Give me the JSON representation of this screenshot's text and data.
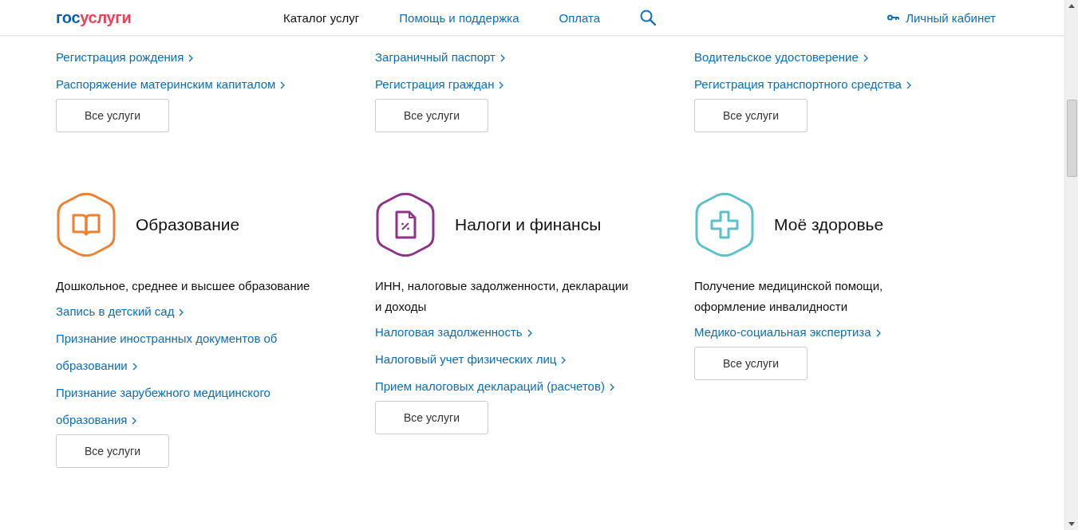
{
  "header": {
    "logo": {
      "part_1": "гос",
      "part_2": "услуги"
    },
    "nav": [
      {
        "label": "Каталог услуг",
        "selected": true
      },
      {
        "label": "Помощь и поддержка",
        "selected": false
      },
      {
        "label": "Оплата",
        "selected": false
      }
    ],
    "account": "Личный кабинет"
  },
  "sections": [
    {
      "kind": "partial",
      "links": [
        "Регистрация рождения",
        "Распоряжение материнским капиталом"
      ],
      "button": "Все услуги"
    },
    {
      "kind": "partial",
      "links": [
        "Заграничный паспорт",
        "Регистрация граждан"
      ],
      "button": "Все услуги"
    },
    {
      "kind": "partial",
      "links": [
        "Водительское удостоверение",
        "Регистрация транспортного средства"
      ],
      "button": "Все услуги"
    },
    {
      "kind": "category",
      "color": "#ee8031",
      "title": "Образование",
      "description": "Дошкольное, среднее и высшее образование",
      "links": [
        "Запись в детский сад",
        "Признание иностранных документов об образовании",
        "Признание зарубежного медицинского образования"
      ],
      "button": "Все услуги"
    },
    {
      "kind": "category",
      "color": "#8f3289",
      "title": "Налоги и финансы",
      "description": "ИНН, налоговые задолженности, декларации и доходы",
      "links": [
        "Налоговая задолженность",
        "Налоговый учет физических лиц",
        "Прием налоговых деклараций (расчетов)"
      ],
      "button": "Все услуги"
    },
    {
      "kind": "category",
      "color": "#5bc2cc",
      "title": "Моё здоровье",
      "description": "Получение медицинской помощи, оформление инвалидности",
      "links": [
        "Медико-социальная экспертиза"
      ],
      "button": "Все услуги"
    }
  ]
}
